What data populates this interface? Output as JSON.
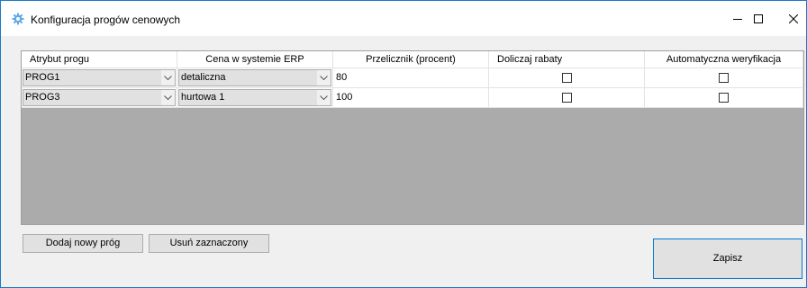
{
  "window": {
    "title": "Konfiguracja progów cenowych",
    "icon": "gear-icon",
    "controls": [
      "minimize-icon",
      "maximize-icon",
      "close-icon"
    ]
  },
  "grid": {
    "columns": [
      "Atrybut progu",
      "Cena w systemie ERP",
      "Przelicznik (procent)",
      "Doliczaj rabaty",
      "Automatyczna weryfikacja"
    ],
    "rows": [
      {
        "atrybut": "PROG1",
        "cena": "detaliczna",
        "przelicznik": "80",
        "rabaty": false,
        "weryfikacja": false
      },
      {
        "atrybut": "PROG3",
        "cena": "hurtowa 1",
        "przelicznik": "100",
        "rabaty": false,
        "weryfikacja": false
      }
    ]
  },
  "buttons": {
    "add": "Dodaj nowy próg",
    "remove": "Usuń zaznaczony",
    "save": "Zapisz"
  },
  "colors": {
    "accent": "#0078d7",
    "grid_background": "#ababab",
    "icon": "#5fa8e6"
  }
}
